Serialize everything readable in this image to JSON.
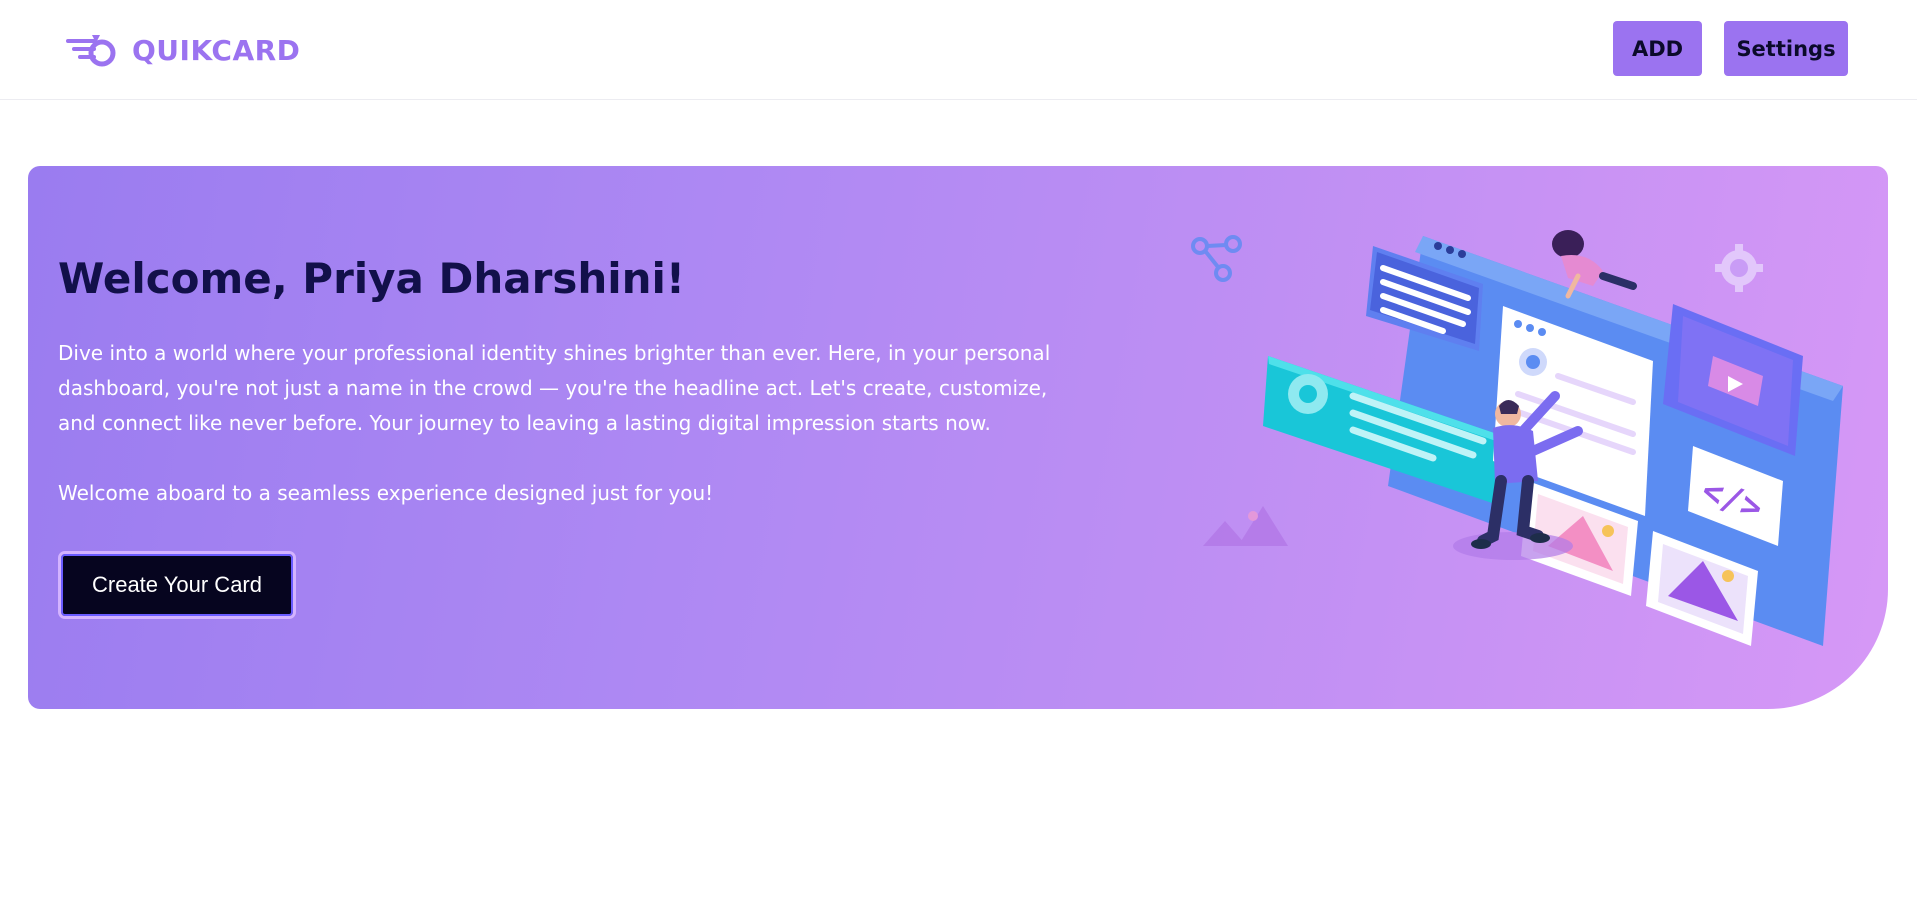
{
  "navbar": {
    "brand": {
      "name": "QUIKCARD",
      "logo_icon": "rocket-card-logo",
      "color": "#9b73f0"
    },
    "actions": {
      "add_label": "ADD",
      "settings_label": "Settings",
      "button_color": "#9b73f0"
    }
  },
  "hero": {
    "title": "Welcome, Priya Dharshini!",
    "description": "Dive into a world where your professional identity shines brighter than ever. Here, in your personal dashboard, you're not just a name in the crowd — you're the headline act. Let's create, customize, and connect like never before. Your journey to leaving a lasting digital impression starts now.",
    "welcome": "Welcome aboard to a seamless experience designed just for you!",
    "cta_label": "Create Your Card",
    "illustration": "web-design-team-illustration",
    "gradient": [
      "#9a7cf0",
      "#d698f6"
    ]
  }
}
